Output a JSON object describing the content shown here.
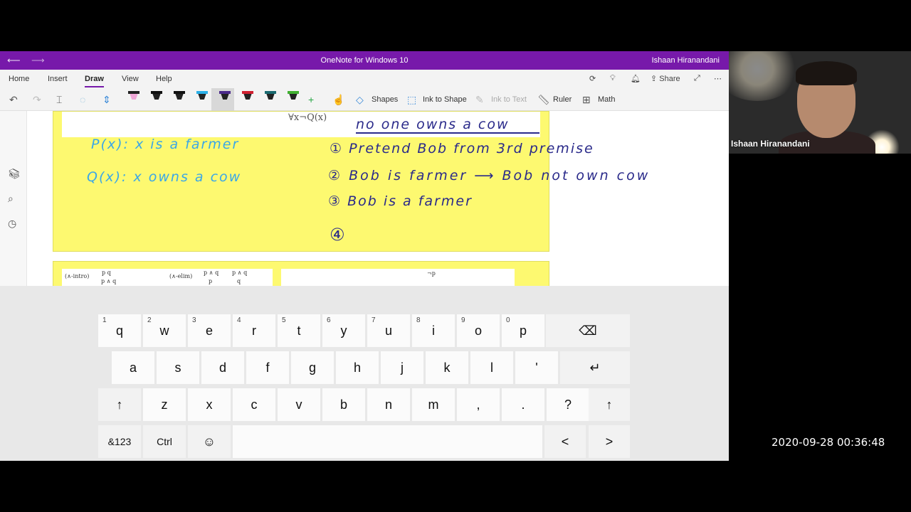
{
  "titlebar": {
    "back_icon": "back-arrow-icon",
    "forward_icon": "forward-arrow-icon",
    "title": "OneNote for Windows 10",
    "user": "Ishaan Hiranandani",
    "color": "#7719aa"
  },
  "menu": {
    "home": "Home",
    "insert": "Insert",
    "draw": "Draw",
    "view": "View",
    "help": "Help",
    "share": "Share"
  },
  "ribbon": {
    "shapes": "Shapes",
    "ink_to_shape": "Ink to Shape",
    "ink_to_text": "Ink to Text",
    "ruler": "Ruler",
    "math": "Math",
    "pens": [
      "#f0a8d8",
      "#111111",
      "#111111",
      "#2ab0e8",
      "#4b2a8a",
      "#d02030",
      "#1a6a70",
      "#40b030"
    ]
  },
  "page": {
    "formula": "∀x¬Q(x)",
    "yellow_color": "#fdf970",
    "ink": {
      "top_right": "no one owns a cow",
      "px": "P(x): x is a farmer",
      "qx": "Q(x): x owns a cow",
      "step1": "① Pretend Bob from 3rd premise",
      "step2": "② Bob is farmer ⟶ Bob not own cow",
      "step3": "③ Bob is a farmer",
      "step4": "④"
    },
    "rules": {
      "and_intro": "(∧-intro)",
      "and_intro_top": "p   q",
      "and_intro_bottom": "p ∧ q",
      "and_elim": "(∧-elim)",
      "and_elim_top1": "p ∧ q",
      "and_elim_bottom1": "p",
      "and_elim_top2": "p ∧ q",
      "and_elim_bottom2": "q",
      "neg_p": "¬p"
    }
  },
  "keyboard": {
    "row1": [
      {
        "num": "1",
        "key": "q"
      },
      {
        "num": "2",
        "key": "w"
      },
      {
        "num": "3",
        "key": "e"
      },
      {
        "num": "4",
        "key": "r"
      },
      {
        "num": "5",
        "key": "t"
      },
      {
        "num": "6",
        "key": "y"
      },
      {
        "num": "7",
        "key": "u"
      },
      {
        "num": "8",
        "key": "i"
      },
      {
        "num": "9",
        "key": "o"
      },
      {
        "num": "0",
        "key": "p"
      }
    ],
    "backspace": "⌫",
    "row2": [
      "a",
      "s",
      "d",
      "f",
      "g",
      "h",
      "j",
      "k",
      "l",
      "'"
    ],
    "enter": "↵",
    "shift": "↑",
    "row3": [
      "z",
      "x",
      "c",
      "v",
      "b",
      "n",
      "m",
      ",",
      ".",
      "?"
    ],
    "symbols": "&123",
    "ctrl": "Ctrl",
    "emoji": "☺",
    "left": "<",
    "right": ">"
  },
  "webcam": {
    "name": "Ishaan Hiranandani"
  },
  "timestamp": "2020-09-28  00:36:48"
}
